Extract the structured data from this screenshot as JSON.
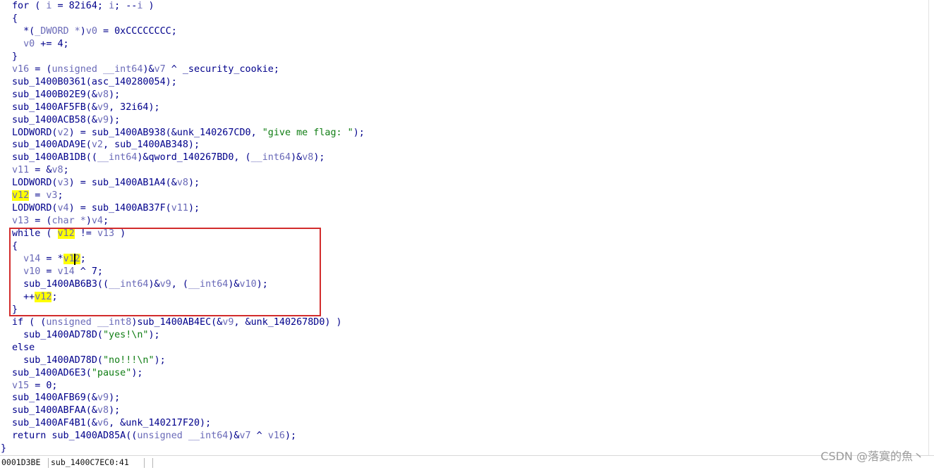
{
  "code_lines": [
    [
      [
        "plain",
        "for ( "
      ],
      [
        "var",
        "i"
      ],
      [
        "plain",
        " = 82i64; "
      ],
      [
        "var",
        "i"
      ],
      [
        "plain",
        "; --"
      ],
      [
        "var",
        "i"
      ],
      [
        "plain",
        " )"
      ]
    ],
    [
      [
        "plain",
        "{"
      ]
    ],
    [
      [
        "plain",
        "  *("
      ],
      [
        "var",
        "_DWORD *"
      ],
      [
        "plain",
        ")"
      ],
      [
        "var",
        "v0"
      ],
      [
        "plain",
        " = 0xCCCCCCCC;"
      ]
    ],
    [
      [
        "plain",
        "  "
      ],
      [
        "var",
        "v0"
      ],
      [
        "plain",
        " += 4;"
      ]
    ],
    [
      [
        "plain",
        "}"
      ]
    ],
    [
      [
        "var",
        "v16"
      ],
      [
        "plain",
        " = ("
      ],
      [
        "var",
        "unsigned __int64"
      ],
      [
        "plain",
        ")&"
      ],
      [
        "var",
        "v7"
      ],
      [
        "plain",
        " ^ _security_cookie;"
      ]
    ],
    [
      [
        "plain",
        "sub_1400B0361(asc_140280054);"
      ]
    ],
    [
      [
        "plain",
        "sub_1400B02E9(&"
      ],
      [
        "var",
        "v8"
      ],
      [
        "plain",
        ");"
      ]
    ],
    [
      [
        "plain",
        "sub_1400AF5FB(&"
      ],
      [
        "var",
        "v9"
      ],
      [
        "plain",
        ", 32i64);"
      ]
    ],
    [
      [
        "plain",
        "sub_1400ACB58(&"
      ],
      [
        "var",
        "v9"
      ],
      [
        "plain",
        ");"
      ]
    ],
    [
      [
        "plain",
        "LODWORD("
      ],
      [
        "var",
        "v2"
      ],
      [
        "plain",
        ") = sub_1400AB938(&unk_140267CD0, "
      ],
      [
        "str",
        "\"give me flag: \""
      ],
      [
        "plain",
        ");"
      ]
    ],
    [
      [
        "plain",
        "sub_1400ADA9E("
      ],
      [
        "var",
        "v2"
      ],
      [
        "plain",
        ", sub_1400AB348);"
      ]
    ],
    [
      [
        "plain",
        "sub_1400AB1DB(("
      ],
      [
        "var",
        "__int64"
      ],
      [
        "plain",
        ")&qword_140267BD0, ("
      ],
      [
        "var",
        "__int64"
      ],
      [
        "plain",
        ")&"
      ],
      [
        "var",
        "v8"
      ],
      [
        "plain",
        ");"
      ]
    ],
    [
      [
        "var",
        "v11"
      ],
      [
        "plain",
        " = &"
      ],
      [
        "var",
        "v8"
      ],
      [
        "plain",
        ";"
      ]
    ],
    [
      [
        "plain",
        "LODWORD("
      ],
      [
        "var",
        "v3"
      ],
      [
        "plain",
        ") = sub_1400AB1A4(&"
      ],
      [
        "var",
        "v8"
      ],
      [
        "plain",
        ");"
      ]
    ],
    [
      [
        "hl",
        "v12"
      ],
      [
        "plain",
        " = "
      ],
      [
        "var",
        "v3"
      ],
      [
        "plain",
        ";"
      ]
    ],
    [
      [
        "plain",
        "LODWORD("
      ],
      [
        "var",
        "v4"
      ],
      [
        "plain",
        ") = sub_1400AB37F("
      ],
      [
        "var",
        "v11"
      ],
      [
        "plain",
        ");"
      ]
    ],
    [
      [
        "var",
        "v13"
      ],
      [
        "plain",
        " = ("
      ],
      [
        "var",
        "char *"
      ],
      [
        "plain",
        ")"
      ],
      [
        "var",
        "v4"
      ],
      [
        "plain",
        ";"
      ]
    ],
    [
      [
        "plain",
        "while ( "
      ],
      [
        "hl",
        "v12"
      ],
      [
        "plain",
        " != "
      ],
      [
        "var",
        "v13"
      ],
      [
        "plain",
        " )"
      ]
    ],
    [
      [
        "plain",
        "{"
      ]
    ],
    [
      [
        "plain",
        "  "
      ],
      [
        "var",
        "v14"
      ],
      [
        "plain",
        " = *"
      ],
      [
        "hl",
        "v12"
      ],
      [
        "plain",
        ";"
      ]
    ],
    [
      [
        "plain",
        "  "
      ],
      [
        "var",
        "v10"
      ],
      [
        "plain",
        " = "
      ],
      [
        "var",
        "v14"
      ],
      [
        "plain",
        " ^ 7;"
      ]
    ],
    [
      [
        "plain",
        "  sub_1400AB6B3(("
      ],
      [
        "var",
        "__int64"
      ],
      [
        "plain",
        ")&"
      ],
      [
        "var",
        "v9"
      ],
      [
        "plain",
        ", ("
      ],
      [
        "var",
        "__int64"
      ],
      [
        "plain",
        ")&"
      ],
      [
        "var",
        "v10"
      ],
      [
        "plain",
        ");"
      ]
    ],
    [
      [
        "plain",
        "  ++"
      ],
      [
        "hl",
        "v12"
      ],
      [
        "plain",
        ";"
      ]
    ],
    [
      [
        "plain",
        "}"
      ]
    ],
    [
      [
        "plain",
        "if ( ("
      ],
      [
        "var",
        "unsigned __int8"
      ],
      [
        "plain",
        ")sub_1400AB4EC(&"
      ],
      [
        "var",
        "v9"
      ],
      [
        "plain",
        ", &unk_1402678D0) )"
      ]
    ],
    [
      [
        "plain",
        "  sub_1400AD78D("
      ],
      [
        "str",
        "\"yes!\\n\""
      ],
      [
        "plain",
        ");"
      ]
    ],
    [
      [
        "plain",
        "else"
      ]
    ],
    [
      [
        "plain",
        "  sub_1400AD78D("
      ],
      [
        "str",
        "\"no!!!\\n\""
      ],
      [
        "plain",
        ");"
      ]
    ],
    [
      [
        "plain",
        "sub_1400AD6E3("
      ],
      [
        "str",
        "\"pause\""
      ],
      [
        "plain",
        ");"
      ]
    ],
    [
      [
        "var",
        "v15"
      ],
      [
        "plain",
        " = 0;"
      ]
    ],
    [
      [
        "plain",
        "sub_1400AFB69(&"
      ],
      [
        "var",
        "v9"
      ],
      [
        "plain",
        ");"
      ]
    ],
    [
      [
        "plain",
        "sub_1400ABFAA(&"
      ],
      [
        "var",
        "v8"
      ],
      [
        "plain",
        ");"
      ]
    ],
    [
      [
        "plain",
        "sub_1400AF4B1(&"
      ],
      [
        "var",
        "v6"
      ],
      [
        "plain",
        ", &unk_140217F20);"
      ]
    ],
    [
      [
        "plain",
        "return sub_1400AD85A(("
      ],
      [
        "var",
        "unsigned __int64"
      ],
      [
        "plain",
        ")&"
      ],
      [
        "var",
        "v7"
      ],
      [
        "plain",
        " ^ "
      ],
      [
        "var",
        "v16"
      ],
      [
        "plain",
        ");"
      ]
    ]
  ],
  "closing_brace": "}",
  "statusbar": {
    "address": "0001D3BE",
    "function": "sub_1400C7EC0:41"
  },
  "watermark": "CSDN @落寞的魚丶",
  "colors": {
    "keyword": "#00008b",
    "variable": "#6a6ab8",
    "string": "#0f7d13",
    "highlight": "#ffff00",
    "selection_box": "#d22c2c"
  }
}
